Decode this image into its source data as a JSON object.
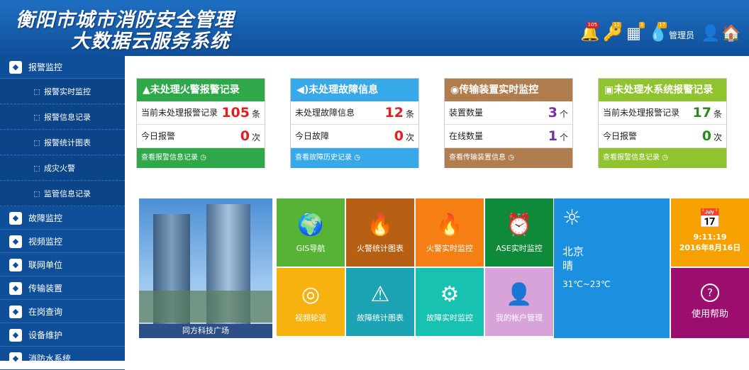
{
  "header": {
    "title_line1": "衡阳市城市消防安全管理",
    "title_line2": "大数据云服务系统",
    "bell_badge": "105",
    "key_badge": "12",
    "building_badge": "3",
    "drop_badge": "17",
    "user_label": "管理员"
  },
  "sidebar": {
    "items": [
      {
        "label": "报警监控",
        "icon": "alarm-icon"
      },
      {
        "label": "报警实时监控",
        "sub": true
      },
      {
        "label": "报警信息记录",
        "sub": true
      },
      {
        "label": "报警统计图表",
        "sub": true
      },
      {
        "label": "成灾火警",
        "sub": true
      },
      {
        "label": "监管信息记录",
        "sub": true
      },
      {
        "label": "故障监控",
        "icon": "warning-icon"
      },
      {
        "label": "视频监控",
        "icon": "camera-icon"
      },
      {
        "label": "联网单位",
        "icon": "building-icon"
      },
      {
        "label": "传输装置",
        "icon": "ase-icon"
      },
      {
        "label": "在岗查询",
        "icon": "search-person-icon"
      },
      {
        "label": "设备维护",
        "icon": "device-icon"
      },
      {
        "label": "消防水系统",
        "icon": "water-icon"
      }
    ]
  },
  "cards": [
    {
      "title": "▲未处理火警报警记录",
      "color": "#2fa84a",
      "rows": [
        {
          "label": "当前未处理报警记录",
          "value": "105",
          "unit": "条",
          "vcolor": "#e02020"
        },
        {
          "label": "今日报警",
          "value": "0",
          "unit": "次",
          "vcolor": "#e02020"
        }
      ],
      "footer": "查看报警信息记录"
    },
    {
      "title": "◀)未处理故障信息",
      "color": "#37a8e8",
      "rows": [
        {
          "label": "未处理故障信息",
          "value": "12",
          "unit": "条",
          "vcolor": "#e02020"
        },
        {
          "label": "今日故障",
          "value": "0",
          "unit": "次",
          "vcolor": "#e02020"
        }
      ],
      "footer": "查看故障历史记录"
    },
    {
      "title": "◉传输装置实时监控",
      "color": "#b07d4f",
      "rows": [
        {
          "label": "装置数量",
          "value": "3",
          "unit": "个",
          "vcolor": "#7a2ca0"
        },
        {
          "label": "在线数量",
          "value": "1",
          "unit": "个",
          "vcolor": "#7a2ca0"
        }
      ],
      "footer": "查看传输装置信息"
    },
    {
      "title": "▣未处理水系统报警记录",
      "color": "#8fc42e",
      "rows": [
        {
          "label": "当前未处理报警记录",
          "value": "17",
          "unit": "条",
          "vcolor": "#2a8a1e"
        },
        {
          "label": "今日报警",
          "value": "0",
          "unit": "次",
          "vcolor": "#2a8a1e"
        }
      ],
      "footer": "查看报警信息记录"
    }
  ],
  "photo_caption": "同方科技广场",
  "tiles": [
    {
      "label": "GIS导航",
      "color": "#56b336",
      "glyph": "🌍"
    },
    {
      "label": "火警统计图表",
      "color": "#b75f12",
      "glyph": "🔥"
    },
    {
      "label": "火警实时监控",
      "color": "#f57e15",
      "glyph": "🔥"
    },
    {
      "label": "ASE实时监控",
      "color": "#0e8a3a",
      "glyph": "⏰"
    },
    {
      "label": "视频轮巡",
      "color": "#f8b20f",
      "glyph": "◎"
    },
    {
      "label": "故障统计图表",
      "color": "#1ba3b3",
      "glyph": "⚠"
    },
    {
      "label": "故障实时监控",
      "color": "#18c2b0",
      "glyph": "⚙"
    },
    {
      "label": "我的帐户管理",
      "color": "#d7a3d9",
      "glyph": "👤"
    }
  ],
  "weather": {
    "city": "北京",
    "condition": "晴",
    "temp": "31℃~23℃"
  },
  "clock": {
    "time": "9:11:19",
    "date": "2016年8月16日"
  },
  "help": {
    "label": "使用帮助"
  }
}
